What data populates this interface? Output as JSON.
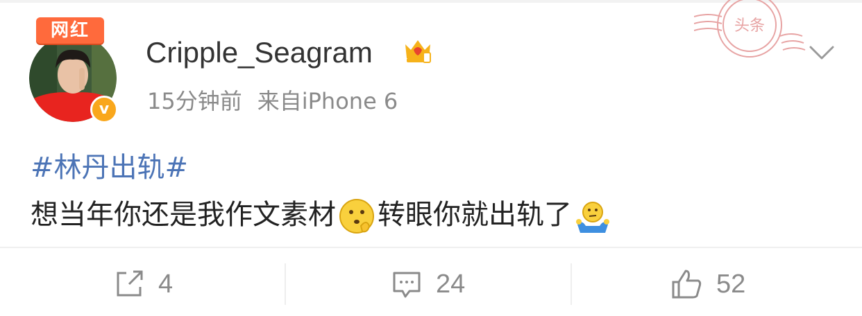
{
  "post": {
    "badge": "网红",
    "username": "Cripple_Seagram",
    "time": "15分钟前",
    "source": "来自iPhone 6",
    "stamp_text": "头条",
    "hashtag": "#林丹出轨#",
    "content_part1": "想当年你还是我作文素材",
    "content_part2": "转眼你就出轨了"
  },
  "actions": {
    "repost_count": "4",
    "comment_count": "24",
    "like_count": "52"
  },
  "icons": {
    "verified": "verified-v-icon",
    "crown": "crown-vip-icon",
    "chevron": "chevron-down-icon",
    "repost": "repost-icon",
    "comment": "comment-icon",
    "like": "thumbs-up-icon"
  },
  "colors": {
    "hashtag": "#4c74b6",
    "badge": "#ff6a3c",
    "verified": "#f9a71c",
    "meta": "#8a8a8a"
  }
}
